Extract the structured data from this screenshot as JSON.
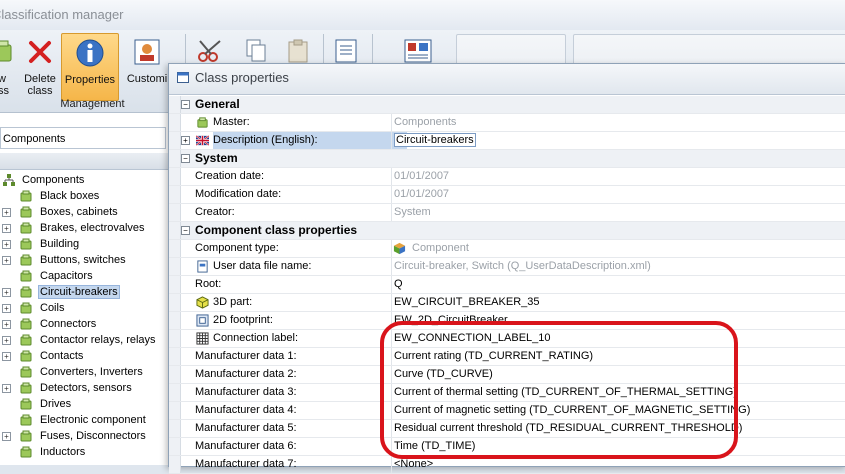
{
  "app": {
    "title": "Classification manager"
  },
  "ribbon": {
    "buttons": [
      {
        "label": "New class"
      },
      {
        "label": "Delete class"
      },
      {
        "label": "Properties"
      },
      {
        "label": "Customi"
      }
    ],
    "group_label": "Management"
  },
  "left": {
    "combo_value": "Components",
    "root_label": "Components",
    "items": [
      {
        "label": "Black boxes",
        "expandable": false
      },
      {
        "label": "Boxes, cabinets",
        "expandable": true
      },
      {
        "label": "Brakes, electrovalves",
        "expandable": true
      },
      {
        "label": "Building",
        "expandable": true
      },
      {
        "label": "Buttons, switches",
        "expandable": true
      },
      {
        "label": "Capacitors",
        "expandable": false
      },
      {
        "label": "Circuit-breakers",
        "expandable": true,
        "selected": true
      },
      {
        "label": "Coils",
        "expandable": true
      },
      {
        "label": "Connectors",
        "expandable": true
      },
      {
        "label": "Contactor relays, relays",
        "expandable": true
      },
      {
        "label": "Contacts",
        "expandable": true
      },
      {
        "label": "Converters, Inverters",
        "expandable": false
      },
      {
        "label": "Detectors, sensors",
        "expandable": true
      },
      {
        "label": "Drives",
        "expandable": false
      },
      {
        "label": "Electronic component",
        "expandable": false
      },
      {
        "label": "Fuses, Disconnectors",
        "expandable": true
      },
      {
        "label": "Inductors",
        "expandable": false
      }
    ]
  },
  "dialog": {
    "title": "Class properties",
    "sections": [
      {
        "label": "General",
        "rows": [
          {
            "name": "Master:",
            "value": "Components",
            "gray": true,
            "icon": "class-icon"
          },
          {
            "name": "Description (English):",
            "value": "Circuit-breakers",
            "gray": false,
            "icon": "flag-icon",
            "selected": true,
            "expandable": true
          }
        ]
      },
      {
        "label": "System",
        "rows": [
          {
            "name": "Creation date:",
            "value": "01/01/2007",
            "gray": true
          },
          {
            "name": "Modification date:",
            "value": "01/01/2007",
            "gray": true
          },
          {
            "name": "Creator:",
            "value": "System",
            "gray": true
          }
        ]
      },
      {
        "label": "Component class properties",
        "rows": [
          {
            "name": "Component type:",
            "value": "Component",
            "gray": true,
            "value_icon": "component-icon"
          },
          {
            "name": "User data file name:",
            "value": "Circuit-breaker, Switch (Q_UserDataDescription.xml)",
            "gray": true,
            "icon": "file-icon"
          },
          {
            "name": "Root:",
            "value": "Q",
            "gray": false
          },
          {
            "name": "3D part:",
            "value": "EW_CIRCUIT_BREAKER_35",
            "gray": false,
            "icon": "3d-part-icon"
          },
          {
            "name": "2D footprint:",
            "value": "EW_2D_CircuitBreaker",
            "gray": false,
            "icon": "footprint-icon"
          },
          {
            "name": "Connection label:",
            "value": "EW_CONNECTION_LABEL_10",
            "gray": false,
            "icon": "connection-label-icon"
          },
          {
            "name": "Manufacturer data 1:",
            "value": "Current rating (TD_CURRENT_RATING)",
            "gray": false
          },
          {
            "name": "Manufacturer data 2:",
            "value": "Curve (TD_CURVE)",
            "gray": false
          },
          {
            "name": "Manufacturer data 3:",
            "value": "Current of thermal setting (TD_CURRENT_OF_THERMAL_SETTING)",
            "gray": false
          },
          {
            "name": "Manufacturer data 4:",
            "value": "Current of magnetic setting (TD_CURRENT_OF_MAGNETIC_SETTING)",
            "gray": false
          },
          {
            "name": "Manufacturer data 5:",
            "value": "Residual current threshold (TD_RESIDUAL_CURRENT_THRESHOLD)",
            "gray": false
          },
          {
            "name": "Manufacturer data 6:",
            "value": "Time (TD_TIME)",
            "gray": false
          },
          {
            "name": "Manufacturer data 7:",
            "value": "<None>",
            "gray": false
          }
        ]
      }
    ]
  },
  "colors": {
    "highlight": "#d9141b",
    "selection": "#c4d7ee",
    "active_button": "#f5b64a"
  }
}
